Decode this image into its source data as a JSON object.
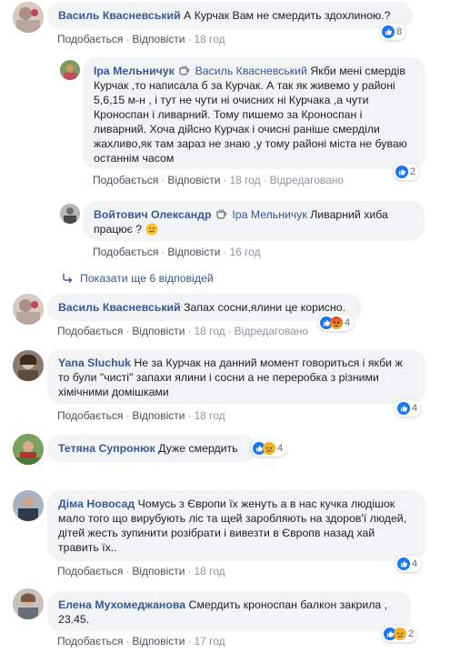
{
  "actions": {
    "like": "Подобається",
    "reply": "Відповісти",
    "edited": "Відредаговано"
  },
  "colors": {
    "link": "#385898",
    "bubble": "#f2f3f5",
    "meta": "#90949c",
    "like_blue": "#1877f2",
    "angry": "#e9710f",
    "sad_yellow": "#f7b125"
  },
  "icons": {
    "moderator_badge": "coffee-cup-icon",
    "like": "like-icon",
    "angry": "angry-icon",
    "sad": "sad-icon",
    "reply_arrow": "reply-arrow-icon"
  },
  "comments": [
    {
      "author": "Василь Квасневський",
      "text": "А Курчак Вам не смердить здохлиною.?",
      "time": "18 год",
      "reactions_count": "8"
    },
    {
      "author": "Іра Мельничук",
      "reply_to": "Василь Квасневський",
      "text": "Якби мені смердів Курчак ,то написала б за Курчак. А так як живемо у районі 5,6,15 м-н , і тут не чути ні очисних ні Курчака ,а чути Кроноспан і ливарний. Тому пишемо за Кроноспан і ливарний. Хоча дійсно Курчак і очисні раніше смерділи жахливо,як там зараз не знаю ,у тому районі міста не буваю останнім часом",
      "time": "18 год",
      "edited": true,
      "reactions_count": "2"
    },
    {
      "author": "Войтович Олександр",
      "reply_to": "Іра Мельничук",
      "text": "Ливарний хиба працює ?",
      "time": "16 год"
    },
    {
      "author": "Василь Квасневський",
      "text": "Запах сосни,ялини це корисно.",
      "time": "18 год",
      "edited": true,
      "reactions_count": "4"
    },
    {
      "author": "Yana Sluchuk",
      "text": "Не за Курчак на данний момент говориться і якби ж то були \"чисті\" запахи ялини і сосни а не переробка з різними хімічними домішками",
      "time": "18 год",
      "reactions_count": "4"
    },
    {
      "author": "Тетяна Супронюк",
      "text": "Дуже смердить",
      "time": "",
      "reactions_count": "4"
    },
    {
      "author": "Діма Новосад",
      "text": "Чомусь з Європи їх женуть а в нас кучка людішок мало того що вирубують ліс та щей заробляють на здоров'ї людей, дітей жесть зупинити розібрати і вивезти в Європв назад хай травить їх..",
      "time": "18 год",
      "reactions_count": "4"
    },
    {
      "author": "Елена Мухомеджанова",
      "text": "Смердить кроноспан балкон закрила , 23.45.",
      "time": "17 год",
      "reactions_count": "2"
    }
  ],
  "show_more": "Показати ще 6 відповідей"
}
